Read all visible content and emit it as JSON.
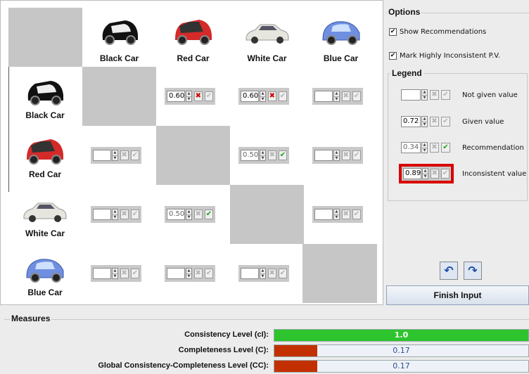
{
  "cars": [
    "Black Car",
    "Red Car",
    "White Car",
    "Blue Car"
  ],
  "matrix": {
    "r0c1": {
      "value": "0.60",
      "reject": "✖",
      "accept": "✔"
    },
    "r0c2": {
      "value": "0.60",
      "reject": "✖",
      "accept": "✔"
    },
    "r0c3": {
      "value": "",
      "reject": "✖",
      "accept": "✔"
    },
    "r1c0": {
      "value": "",
      "reject": "✖",
      "accept": "✔"
    },
    "r1c2": {
      "value": "0.50",
      "reject": "✖",
      "accept": "✔"
    },
    "r1c3": {
      "value": "",
      "reject": "✖",
      "accept": "✔"
    },
    "r2c0": {
      "value": "",
      "reject": "✖",
      "accept": "✔"
    },
    "r2c1": {
      "value": "0.50",
      "reject": "✖",
      "accept": "✔"
    },
    "r2c3": {
      "value": "",
      "reject": "✖",
      "accept": "✔"
    },
    "r3c0": {
      "value": "",
      "reject": "✖",
      "accept": "✔"
    },
    "r3c1": {
      "value": "",
      "reject": "✖",
      "accept": "✔"
    },
    "r3c2": {
      "value": "",
      "reject": "✖",
      "accept": "✔"
    }
  },
  "options": {
    "title": "Options",
    "show_recommendations": "Show Recommendations",
    "mark_inconsistent": "Mark Highly Inconsistent P.V."
  },
  "legend": {
    "title": "Legend",
    "items": [
      {
        "value": "",
        "label": "Not given value"
      },
      {
        "value": "0.72",
        "label": "Given value"
      },
      {
        "value": "0.34",
        "label": "Recommendation"
      },
      {
        "value": "0.89",
        "label": "Inconsistent value"
      }
    ]
  },
  "finish_label": "Finish Input",
  "measures": {
    "title": "Measures",
    "rows": [
      {
        "label": "Consistency Level (cI):",
        "value": "1.0",
        "fraction": 1.0,
        "color": "#2dc42d"
      },
      {
        "label": "Completeness Level (C):",
        "value": "0.17",
        "fraction": 0.17,
        "color": "#c33000"
      },
      {
        "label": "Global Consistency-Completeness Level (CC):",
        "value": "0.17",
        "fraction": 0.17,
        "color": "#c33000"
      }
    ]
  },
  "colors": {
    "black_car": "#151515",
    "red_car": "#d42a2a",
    "white_car": "#e8e8e0",
    "blue_car": "#6f8fe0"
  }
}
